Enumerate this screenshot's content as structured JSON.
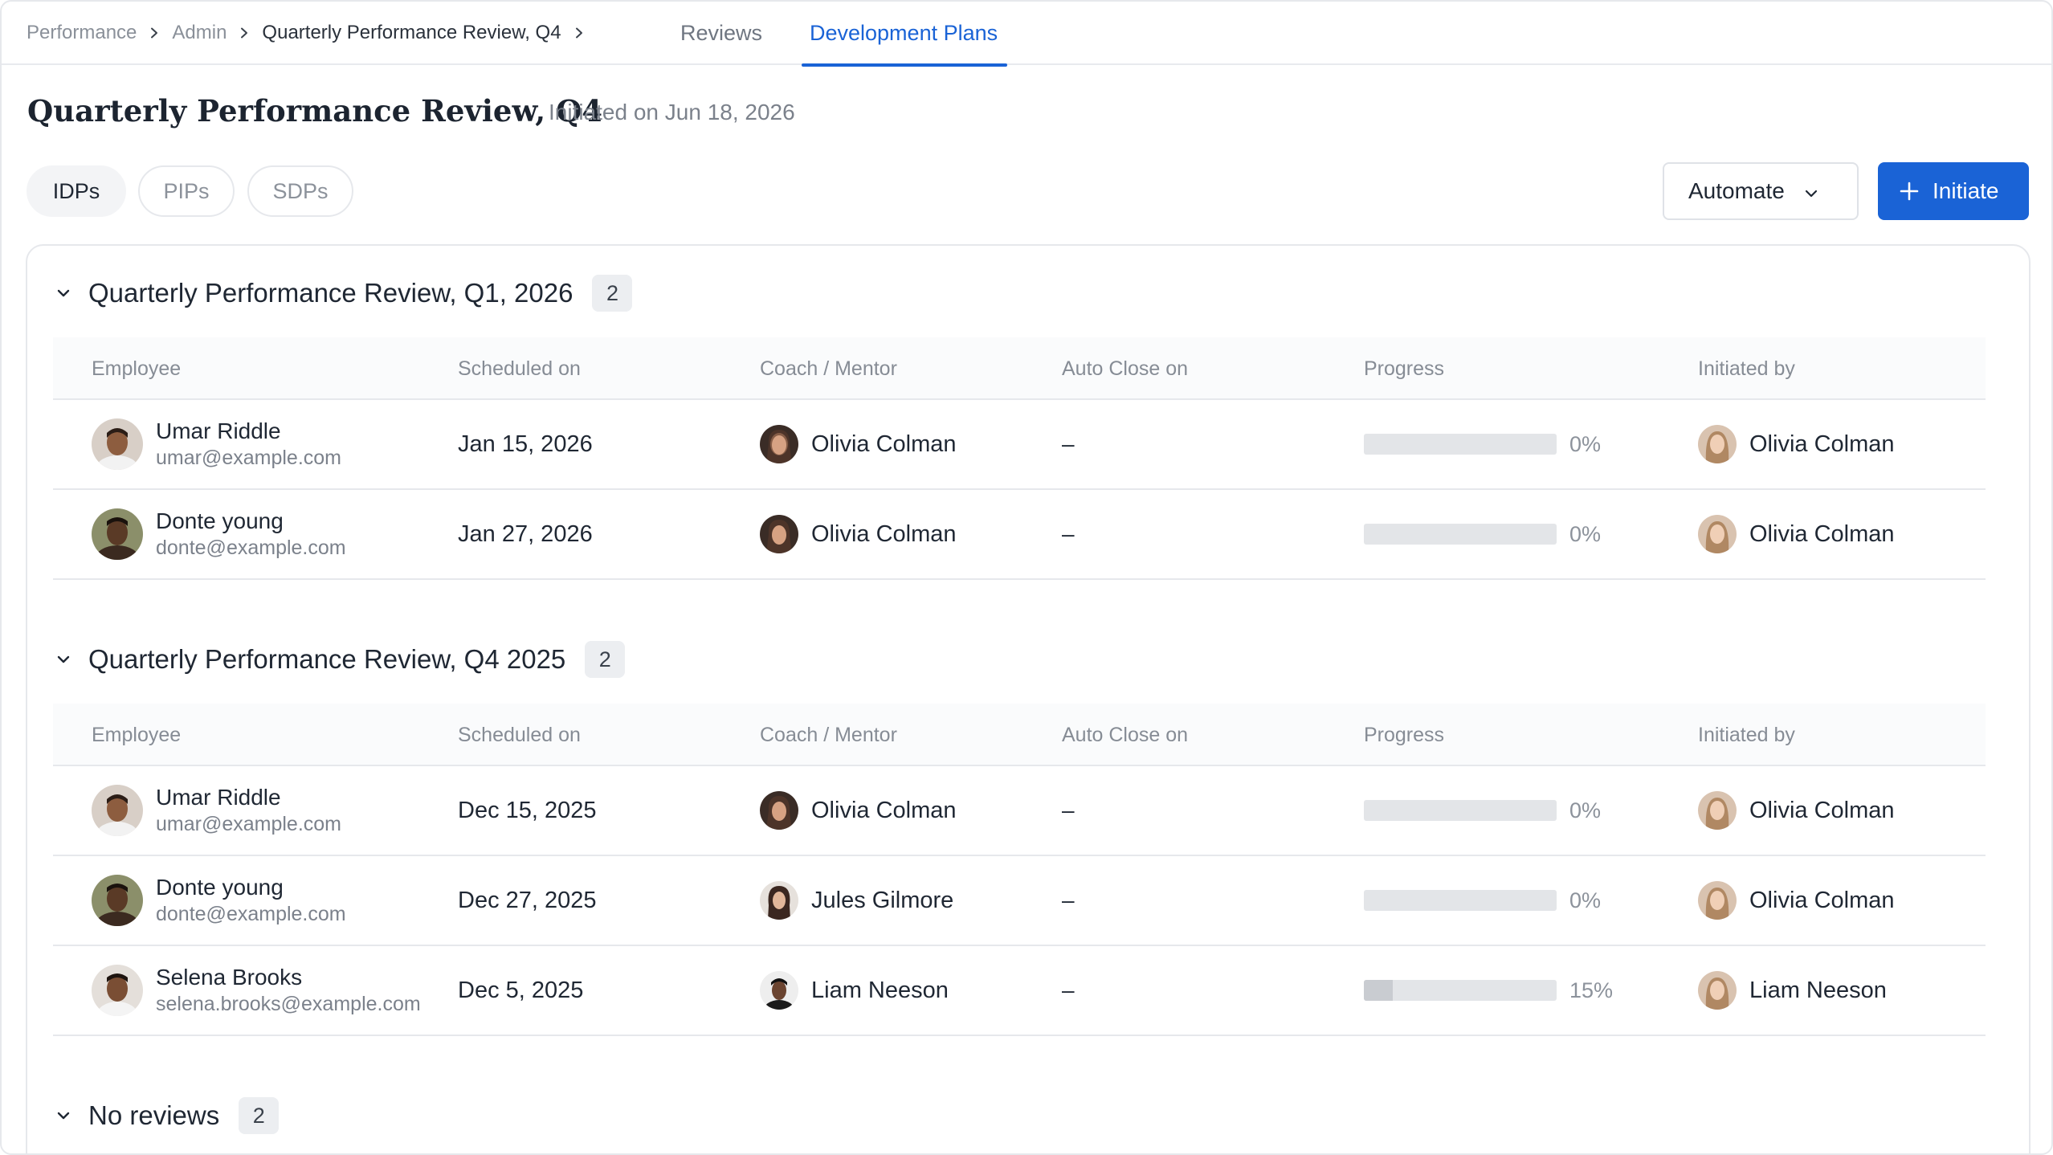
{
  "breadcrumb": {
    "items": [
      "Performance",
      "Admin",
      "Quarterly Performance Review, Q4"
    ]
  },
  "nav_tabs": [
    {
      "label": "Reviews",
      "active": false
    },
    {
      "label": "Development Plans",
      "active": true
    }
  ],
  "page": {
    "title": "Quarterly Performance Review, Q4",
    "subtitle": "Initiated on Jun 18, 2026"
  },
  "plan_types": [
    {
      "label": "IDPs",
      "active": true
    },
    {
      "label": "PIPs",
      "active": false
    },
    {
      "label": "SDPs",
      "active": false
    }
  ],
  "actions": {
    "automate_label": "Automate",
    "initiate_label": "Initiate"
  },
  "colors": {
    "accent": "#1a63d6",
    "border": "#e6e8ec",
    "progress_track": "#e3e5e8"
  },
  "columns": [
    "Employee",
    "Scheduled on",
    "Coach / Mentor",
    "Auto Close on",
    "Progress",
    "Initiated by"
  ],
  "groups": [
    {
      "title": "Quarterly Performance Review, Q1, 2026",
      "count": "2",
      "rows": [
        {
          "name": "Umar Riddle",
          "email": "umar@example.com",
          "scheduled": "Jan 15, 2026",
          "coach": "Olivia Colman",
          "auto_close": "–",
          "progress": 0,
          "progress_label": "0%",
          "initiated_by": "Olivia Colman"
        },
        {
          "name": "Donte young",
          "email": "donte@example.com",
          "scheduled": "Jan 27, 2026",
          "coach": "Olivia Colman",
          "auto_close": "–",
          "progress": 0,
          "progress_label": "0%",
          "initiated_by": "Olivia Colman"
        }
      ]
    },
    {
      "title": "Quarterly Performance Review, Q4 2025",
      "count": "2",
      "rows": [
        {
          "name": "Umar Riddle",
          "email": "umar@example.com",
          "scheduled": "Dec 15, 2025",
          "coach": "Olivia Colman",
          "auto_close": "–",
          "progress": 0,
          "progress_label": "0%",
          "initiated_by": "Olivia Colman"
        },
        {
          "name": "Donte young",
          "email": "donte@example.com",
          "scheduled": "Dec 27, 2025",
          "coach": "Jules Gilmore",
          "auto_close": "–",
          "progress": 0,
          "progress_label": "0%",
          "initiated_by": "Olivia Colman"
        },
        {
          "name": "Selena Brooks",
          "email": "selena.brooks@example.com",
          "scheduled": "Dec 5, 2025",
          "coach": "Liam Neeson",
          "auto_close": "–",
          "progress": 15,
          "progress_label": "15%",
          "initiated_by": "Liam Neeson"
        }
      ]
    },
    {
      "title": "No reviews",
      "count": "2",
      "rows": []
    }
  ]
}
